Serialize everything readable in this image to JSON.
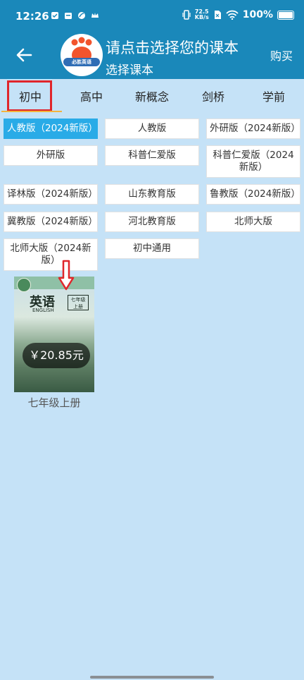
{
  "status_bar": {
    "time": "12:26",
    "net_speed_value": "72.5",
    "net_speed_unit": "KB/s",
    "battery": "100%"
  },
  "header": {
    "title": "请点击选择您的课本",
    "subtitle": "选择课本",
    "buy_label": "购买",
    "logo_text": "必胜英语"
  },
  "tabs": [
    {
      "label": "初中",
      "active": true
    },
    {
      "label": "高中"
    },
    {
      "label": "新概念"
    },
    {
      "label": "剑桥"
    },
    {
      "label": "学前"
    }
  ],
  "editions": [
    {
      "label": "人教版（2024新版）",
      "selected": true
    },
    {
      "label": "人教版"
    },
    {
      "label": "外研版（2024新版）"
    },
    {
      "label": "外研版"
    },
    {
      "label": "科普仁爱版"
    },
    {
      "label": "科普仁爱版（2024新版）"
    },
    {
      "label": "译林版（2024新版）"
    },
    {
      "label": "山东教育版"
    },
    {
      "label": "鲁教版（2024新版）"
    },
    {
      "label": "冀教版（2024新版）"
    },
    {
      "label": "河北教育版"
    },
    {
      "label": "北师大版"
    },
    {
      "label": "北师大版（2024新版）"
    },
    {
      "label": "初中通用"
    }
  ],
  "book": {
    "cover_title": "英语",
    "cover_subtitle": "ENGLISH",
    "cover_grade": "七年级",
    "cover_volume": "上册",
    "price": "￥20.85元",
    "label": "七年级上册"
  },
  "colors": {
    "header_bg": "#1a88ba",
    "page_bg": "#c5e2f7",
    "selected_chip": "#29abe7",
    "annotation_red": "#e0262b"
  }
}
